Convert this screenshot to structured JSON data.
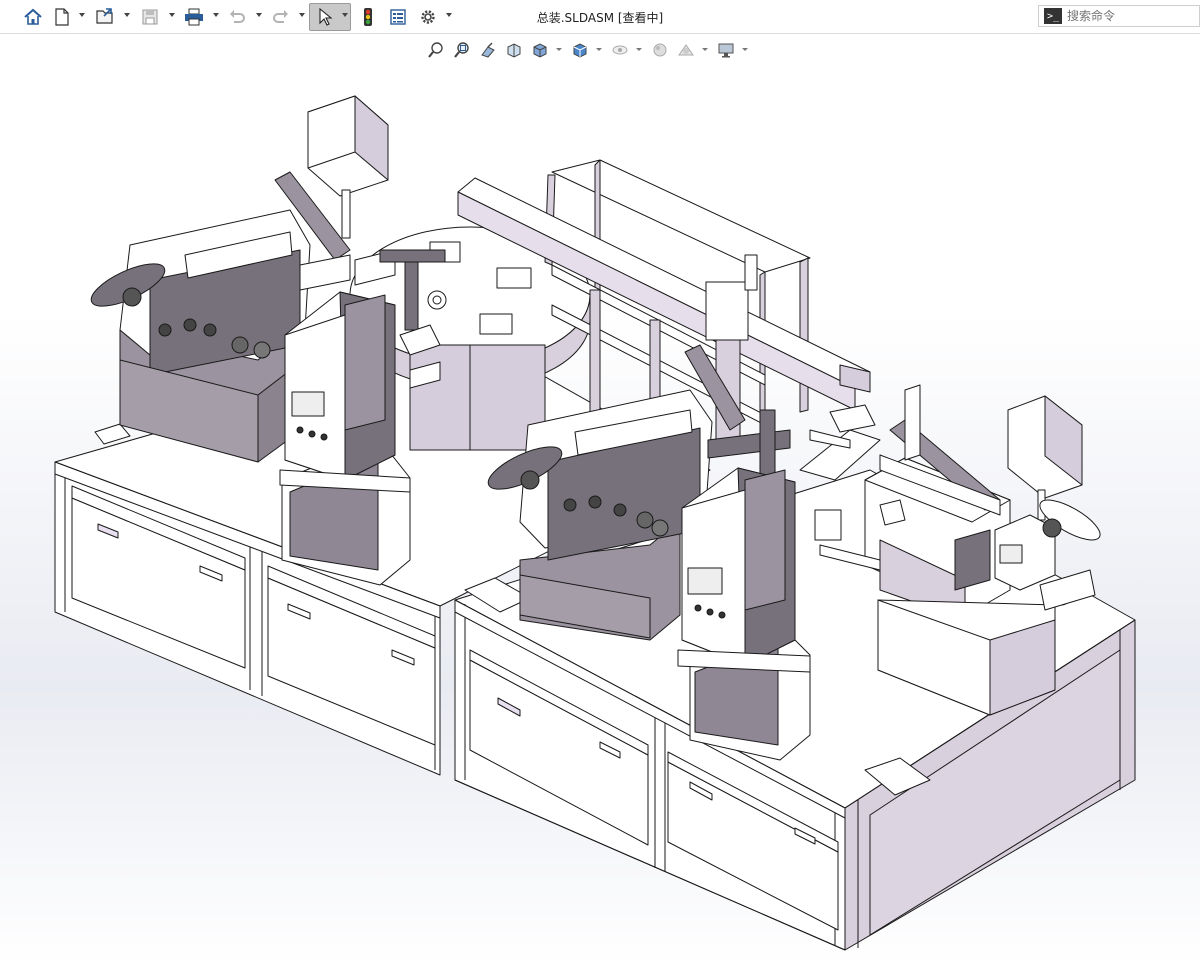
{
  "toolbar": {
    "title": "总装.SLDASM [查看中]",
    "items": [
      {
        "name": "home-icon"
      },
      {
        "name": "new-document-icon"
      },
      {
        "name": "open-file-icon"
      },
      {
        "name": "save-icon"
      },
      {
        "name": "print-icon"
      },
      {
        "name": "undo-icon"
      },
      {
        "name": "redo-icon"
      },
      {
        "name": "select-pointer-icon"
      },
      {
        "name": "rebuild-traffic-light-icon"
      },
      {
        "name": "file-properties-icon"
      },
      {
        "name": "gear-icon"
      }
    ]
  },
  "search": {
    "placeholder": "搜索命令",
    "prompt_glyph": ">_"
  },
  "view_toolbar": {
    "items": [
      {
        "name": "zoom-to-fit-icon"
      },
      {
        "name": "zoom-to-area-icon"
      },
      {
        "name": "previous-view-icon"
      },
      {
        "name": "section-view-icon"
      },
      {
        "name": "view-orientation-icon"
      },
      {
        "name": "display-style-icon"
      },
      {
        "name": "hide-show-items-icon"
      },
      {
        "name": "edit-appearance-icon"
      },
      {
        "name": "apply-scene-icon"
      },
      {
        "name": "view-settings-icon"
      }
    ]
  },
  "colors": {
    "part_face": "#ffffff",
    "part_shade": "#d8cfdd",
    "part_dark": "#8f8794",
    "edge": "#1a1a1a",
    "selected_bg": "#c9c9c9"
  }
}
